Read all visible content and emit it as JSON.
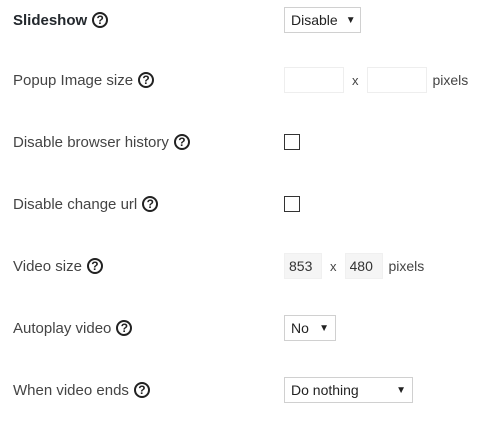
{
  "settings": {
    "slideshow": {
      "label": "Slideshow",
      "value": "Disable"
    },
    "popup_size": {
      "label": "Popup Image size",
      "width": "",
      "height": "",
      "separator": "x",
      "unit": "pixels"
    },
    "browser_history": {
      "label": "Disable browser history",
      "checked": false
    },
    "change_url": {
      "label": "Disable change url",
      "checked": false
    },
    "video_size": {
      "label": "Video size",
      "width": "853",
      "height": "480",
      "separator": "x",
      "unit": "pixels"
    },
    "autoplay": {
      "label": "Autoplay video",
      "value": "No"
    },
    "video_ends": {
      "label": "When video ends",
      "value": "Do nothing"
    }
  },
  "icons": {
    "help": "help-circle-icon",
    "dropdown": "caret-down-icon"
  },
  "help_glyph": "?",
  "caret_glyph": "▼"
}
